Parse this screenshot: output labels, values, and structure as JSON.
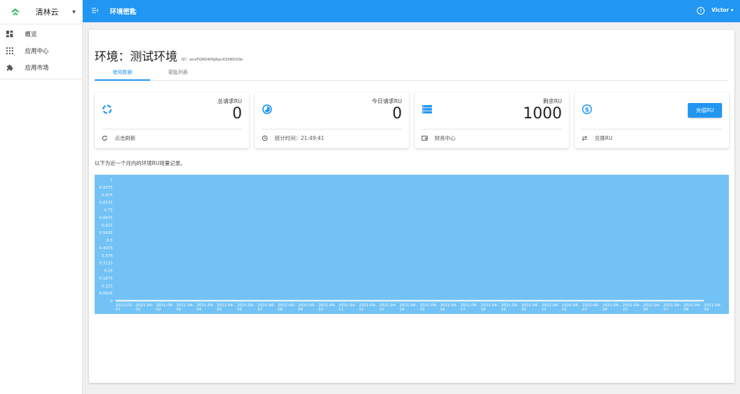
{
  "sidebar": {
    "brand": "清林云",
    "items": [
      {
        "label": "概览",
        "icon": "dashboard-icon"
      },
      {
        "label": "应用中心",
        "icon": "apps-grid-icon"
      },
      {
        "label": "应用市场",
        "icon": "puzzle-icon"
      }
    ]
  },
  "header": {
    "title": "环境密匙",
    "help": "?",
    "user": "Victor ▾"
  },
  "env": {
    "title": "环境：测试环境",
    "id_label": "ID：envFQ6D40Sj6acXSXNVUSk"
  },
  "tabs": [
    {
      "label": "使用数据",
      "active": true
    },
    {
      "label": "密匙列表",
      "active": false
    }
  ],
  "stats": [
    {
      "label": "总请求RU",
      "value": "0",
      "icon": "loading-circle-icon",
      "footer": "点击刷新",
      "footer_icon": "refresh-icon"
    },
    {
      "label": "今日请求RU",
      "value": "0",
      "icon": "pie-clock-icon",
      "footer": "统计时间：21:49:41",
      "footer_icon": "history-icon"
    },
    {
      "label": "剩余RU",
      "value": "1000",
      "icon": "storage-icon",
      "footer": "财务中心",
      "footer_icon": "wallet-icon"
    },
    {
      "label": "",
      "value": "",
      "icon": "dollar-circle-icon",
      "button": "充值RU",
      "footer": "兑换RU",
      "footer_icon": "swap-icon"
    }
  ],
  "note": "以下为近一个月内的环境RU用量记录。",
  "colors": {
    "primary": "#2196f3",
    "chart_bg": "#72c2f5"
  },
  "chart_data": {
    "type": "area",
    "title": "",
    "xlabel": "",
    "ylabel": "",
    "x": [
      "2021-03-31",
      "2021-04-01",
      "2021-04-02",
      "2021-04-03",
      "2021-04-04",
      "2021-04-05",
      "2021-04-06",
      "2021-04-07",
      "2021-04-08",
      "2021-04-09",
      "2021-04-10",
      "2021-04-11",
      "2021-04-12",
      "2021-04-13",
      "2021-04-14",
      "2021-04-15",
      "2021-04-16",
      "2021-04-17",
      "2021-04-18",
      "2021-04-19",
      "2021-04-20",
      "2021-04-21",
      "2021-04-22",
      "2021-04-23",
      "2021-04-24",
      "2021-04-25",
      "2021-04-26",
      "2021-04-27",
      "2021-04-28",
      "2021-04-29"
    ],
    "x_ticks": [
      [
        "2021-03-",
        "31"
      ],
      [
        "2021-04-",
        "01"
      ],
      [
        "2021-04-",
        "02"
      ],
      [
        "2021-04-",
        "03"
      ],
      [
        "2021-04-",
        "04"
      ],
      [
        "2021-04-",
        "05"
      ],
      [
        "2021-04-",
        "06"
      ],
      [
        "2021-04-",
        "07"
      ],
      [
        "2021-04-",
        "08"
      ],
      [
        "2021-04-",
        "09"
      ],
      [
        "2021-04-",
        "10"
      ],
      [
        "2021-04-",
        "11"
      ],
      [
        "2021-04-",
        "12"
      ],
      [
        "2021-04-",
        "13"
      ],
      [
        "2021-04-",
        "14"
      ],
      [
        "2021-04-",
        "15"
      ],
      [
        "2021-04-",
        "16"
      ],
      [
        "2021-04-",
        "17"
      ],
      [
        "2021-04-",
        "18"
      ],
      [
        "2021-04-",
        "19"
      ],
      [
        "2021-04-",
        "20"
      ],
      [
        "2021-04-",
        "21"
      ],
      [
        "2021-04-",
        "22"
      ],
      [
        "2021-04-",
        "23"
      ],
      [
        "2021-04-",
        "24"
      ],
      [
        "2021-04-",
        "25"
      ],
      [
        "2021-04-",
        "26"
      ],
      [
        "2021-04-",
        "27"
      ],
      [
        "2021-04-",
        "28"
      ],
      [
        "2021-04-",
        "29"
      ]
    ],
    "y_ticks": [
      "1",
      "0.9375",
      "0.875",
      "0.8125",
      "0.75",
      "0.6875",
      "0.625",
      "0.5625",
      "0.5",
      "0.4375",
      "0.375",
      "0.3125",
      "0.25",
      "0.1875",
      "0.125",
      "0.0625",
      "0"
    ],
    "ylim": [
      0,
      1
    ],
    "values": [
      0,
      0,
      0,
      0,
      0,
      0,
      0,
      0,
      0,
      0,
      0,
      0,
      0,
      0,
      0,
      0,
      0,
      0,
      0,
      0,
      0,
      0,
      0,
      0,
      0,
      0,
      0,
      0,
      0,
      0
    ],
    "grid": false
  }
}
